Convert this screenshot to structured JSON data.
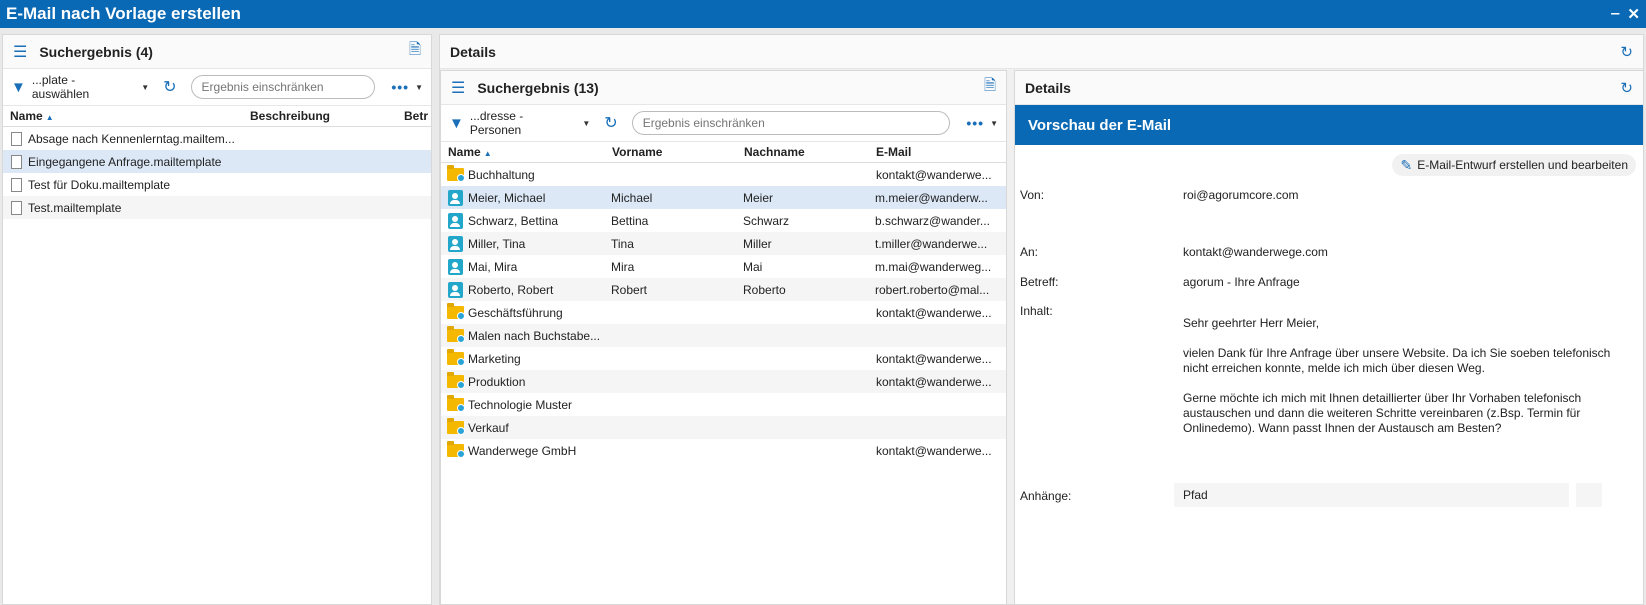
{
  "window": {
    "title": "E-Mail nach Vorlage erstellen",
    "minimize": "‒",
    "close": "✕"
  },
  "left_panel": {
    "title": "Suchergebnis (4)",
    "filter_label": "...plate - auswählen",
    "search_placeholder": "Ergebnis einschränken",
    "more": "•••",
    "columns": [
      "Name",
      "Beschreibung",
      "Betr"
    ],
    "rows": [
      {
        "name": "Absage nach Kennenlerntag.mailtem..."
      },
      {
        "name": "Eingegangene Anfrage.mailtemplate"
      },
      {
        "name": "Test für Doku.mailtemplate"
      },
      {
        "name": "Test.mailtemplate"
      }
    ]
  },
  "details_outer": {
    "title": "Details"
  },
  "middle_panel": {
    "title": "Suchergebnis (13)",
    "filter_label": "...dresse - Personen",
    "search_placeholder": "Ergebnis einschränken",
    "more": "•••",
    "columns": [
      "Name",
      "Vorname",
      "Nachname",
      "E-Mail"
    ],
    "rows": [
      {
        "type": "folder",
        "name": "Buchhaltung",
        "vorname": "",
        "nachname": "",
        "email": "kontakt@wanderwe..."
      },
      {
        "type": "person",
        "name": "Meier, Michael",
        "vorname": "Michael",
        "nachname": "Meier",
        "email": "m.meier@wanderw..."
      },
      {
        "type": "person",
        "name": "Schwarz, Bettina",
        "vorname": "Bettina",
        "nachname": "Schwarz",
        "email": "b.schwarz@wander..."
      },
      {
        "type": "person",
        "name": "Miller, Tina",
        "vorname": "Tina",
        "nachname": "Miller",
        "email": "t.miller@wanderwe..."
      },
      {
        "type": "person",
        "name": "Mai, Mira",
        "vorname": "Mira",
        "nachname": "Mai",
        "email": "m.mai@wanderweg..."
      },
      {
        "type": "person",
        "name": "Roberto, Robert",
        "vorname": "Robert",
        "nachname": "Roberto",
        "email": "robert.roberto@mal..."
      },
      {
        "type": "folder",
        "name": "Geschäftsführung",
        "vorname": "",
        "nachname": "",
        "email": "kontakt@wanderwe..."
      },
      {
        "type": "folder",
        "name": "Malen nach Buchstabe...",
        "vorname": "",
        "nachname": "",
        "email": ""
      },
      {
        "type": "folder",
        "name": "Marketing",
        "vorname": "",
        "nachname": "",
        "email": "kontakt@wanderwe..."
      },
      {
        "type": "folder",
        "name": "Produktion",
        "vorname": "",
        "nachname": "",
        "email": "kontakt@wanderwe..."
      },
      {
        "type": "folder",
        "name": "Technologie Muster",
        "vorname": "",
        "nachname": "",
        "email": ""
      },
      {
        "type": "folder",
        "name": "Verkauf",
        "vorname": "",
        "nachname": "",
        "email": ""
      },
      {
        "type": "folder",
        "name": "Wanderwege GmbH",
        "vorname": "",
        "nachname": "",
        "email": "kontakt@wanderwe..."
      }
    ]
  },
  "right_panel": {
    "title": "Details",
    "preview_title": "Vorschau der E-Mail",
    "draft_button": "E-Mail-Entwurf erstellen und bearbeiten",
    "labels": {
      "von": "Von:",
      "an": "An:",
      "betreff": "Betreff:",
      "inhalt": "Inhalt:",
      "anhaenge": "Anhänge:"
    },
    "von": "roi@agorumcore.com",
    "an": "kontakt@wanderwege.com",
    "betreff": "agorum - Ihre Anfrage",
    "body": [
      "Sehr geehrter Herr  Meier,",
      "vielen Dank für Ihre Anfrage über unsere Website. Da ich Sie soeben telefonisch nicht erreichen konnte, melde ich mich über diesen Weg.",
      "Gerne möchte ich mich mit Ihnen detaillierter über Ihr Vorhaben telefonisch austauschen und dann die weiteren Schritte vereinbaren (z.Bsp. Termin für Onlinedemo). Wann passt Ihnen der Austausch am Besten?"
    ],
    "attachments_label": "Pfad"
  },
  "icons": {
    "menu": "hamburger-icon",
    "document": "document-icon",
    "refresh": "refresh-icon",
    "filter": "funnel-icon",
    "folder": "folder-icon",
    "person": "person-icon",
    "pencil": "pencil-icon"
  },
  "colors": {
    "accent": "#0a69b4",
    "selection": "#dde8f7",
    "folder": "#f5b800",
    "person": "#22a6c9"
  }
}
